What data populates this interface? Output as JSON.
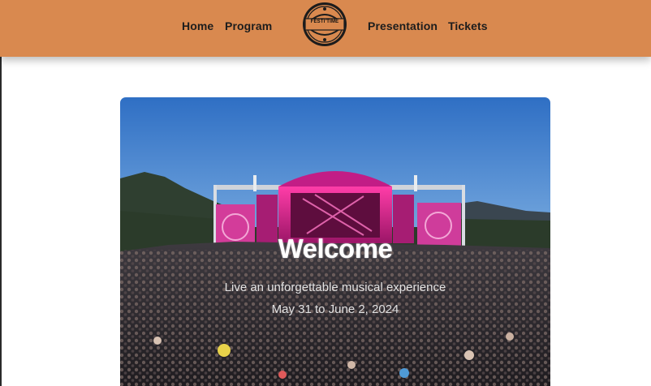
{
  "colors": {
    "header_bg": "#d9894f",
    "nav_text": "#1d1d1d",
    "page_bg": "#ffffff",
    "hero_text": "#ffffff"
  },
  "nav": {
    "items": [
      {
        "label": "Home"
      },
      {
        "label": "Program"
      },
      {
        "label": "Presentation"
      },
      {
        "label": "Tickets"
      }
    ]
  },
  "logo": {
    "text": "FESTI'TIME",
    "icon": "festival-logo-badge"
  },
  "hero": {
    "title": "Welcome",
    "subtitle": "Live an unforgettable musical experience",
    "dates": "May 31 to June 2, 2024",
    "image": "festival-stage-crowd-photo"
  }
}
